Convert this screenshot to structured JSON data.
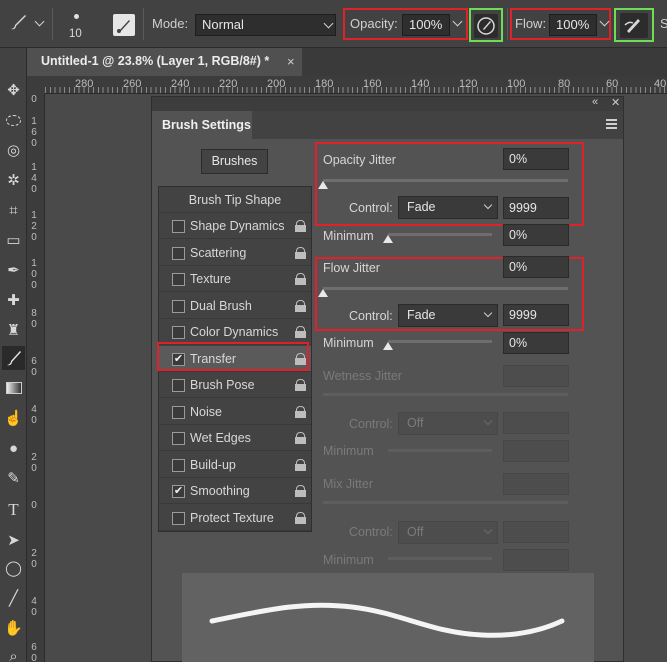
{
  "options_bar": {
    "brush_size": "10",
    "mode_label": "Mode:",
    "mode_value": "Normal",
    "opacity_label": "Opacity:",
    "opacity_value": "100%",
    "flow_label": "Flow:",
    "flow_value": "100%",
    "trailing_text": "S"
  },
  "document": {
    "tab_title": "Untitled-1 @ 23.8% (Layer 1, RGB/8#) *",
    "close": "×"
  },
  "rulers": {
    "horizontal": [
      "280",
      "260",
      "240",
      "220",
      "200",
      "180",
      "160",
      "140",
      "120",
      "100",
      "80",
      "60",
      "40"
    ],
    "vertical": [
      "0",
      "160",
      "140",
      "120",
      "100",
      "80",
      "60",
      "40",
      "20",
      "0",
      "20",
      "40",
      "60"
    ]
  },
  "panel": {
    "title": "Brush Settings",
    "collapse": "«",
    "close": "✕",
    "brushes_button": "Brushes",
    "list_header": "Brush Tip Shape",
    "items": [
      {
        "label": "Shape Dynamics",
        "checked": false
      },
      {
        "label": "Scattering",
        "checked": false
      },
      {
        "label": "Texture",
        "checked": false
      },
      {
        "label": "Dual Brush",
        "checked": false
      },
      {
        "label": "Color Dynamics",
        "checked": false
      },
      {
        "label": "Transfer",
        "checked": true
      },
      {
        "label": "Brush Pose",
        "checked": false
      },
      {
        "label": "Noise",
        "checked": false
      },
      {
        "label": "Wet Edges",
        "checked": false
      },
      {
        "label": "Build-up",
        "checked": false
      },
      {
        "label": "Smoothing",
        "checked": true
      },
      {
        "label": "Protect Texture",
        "checked": false
      }
    ],
    "checkmark": "✔",
    "opacity_jitter": {
      "label": "Opacity Jitter",
      "value": "0%",
      "control_label": "Control:",
      "control_value": "Fade",
      "fade_steps": "9999"
    },
    "opacity_minimum": {
      "label": "Minimum",
      "value": "0%"
    },
    "flow_jitter": {
      "label": "Flow Jitter",
      "value": "0%",
      "control_label": "Control:",
      "control_value": "Fade",
      "fade_steps": "9999"
    },
    "flow_minimum": {
      "label": "Minimum",
      "value": "0%"
    },
    "wetness_jitter": {
      "label": "Wetness Jitter",
      "control_label": "Control:",
      "control_value": "Off",
      "minimum_label": "Minimum"
    },
    "mix_jitter": {
      "label": "Mix Jitter",
      "control_label": "Control:",
      "control_value": "Off",
      "minimum_label": "Minimum"
    }
  },
  "colors": {
    "highlight_red": "#e0202a",
    "highlight_green": "#6edc55"
  }
}
